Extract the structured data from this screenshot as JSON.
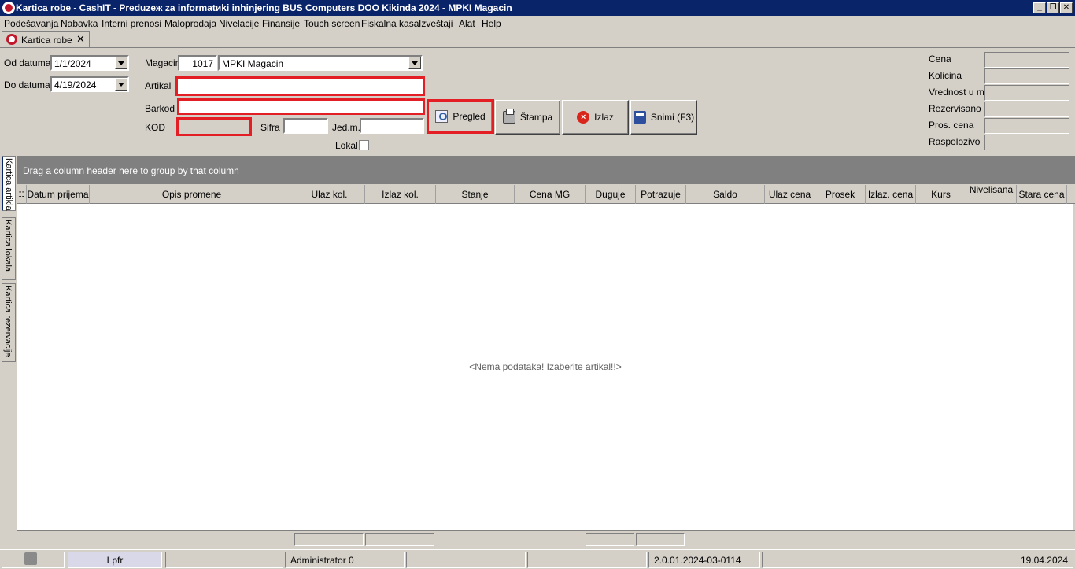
{
  "window": {
    "title": "Kartica robe - CashIT - Preduzeж za informatиki inhinjering BUS Computers DOO Kikinda 2024 - MPKI Magacin",
    "controls": [
      "_",
      "❐",
      "✕"
    ]
  },
  "menu": [
    "Podešavanja",
    "Nabavka",
    "Interni prenosi",
    "Maloprodaja",
    "Nivelacije",
    "Finansije",
    "Touch screen",
    "Fiskalna kasa",
    "Izveštaji",
    "Alat",
    "Help"
  ],
  "tab": {
    "label": "Kartica robe",
    "close": "✕"
  },
  "form": {
    "od_datuma_label": "Od datuma",
    "od_datuma": "1/1/2024",
    "do_datuma_label": "Do datuma",
    "do_datuma": "4/19/2024",
    "magacin_label": "Magacin",
    "magacin_code": "1017",
    "magacin_name": "MPKI Magacin",
    "artikal_label": "Artikal",
    "artikal_value": "",
    "barkod_label": "Barkod",
    "barkod_value": "",
    "kod_label": "KOD",
    "sifra_label": "Sifra",
    "jedm_label": "Jed.m.",
    "lokal_label": "Lokal"
  },
  "buttons": {
    "pregled": "Pregled",
    "stampa": "Štampa",
    "izlaz": "Izlaz",
    "snimi": "Snimi (F3)"
  },
  "summary": {
    "cena": "Cena",
    "kolicina": "Kolicina",
    "vrednost": "Vrednost u mg",
    "rezervisano": "Rezervisano",
    "pros_cena": "Pros. cena",
    "raspolozivo": "Raspolozivo"
  },
  "grid": {
    "group_panel_text": "Drag a column header here to group by that column",
    "columns": [
      "Datum prijema",
      "Opis promene",
      "Ulaz kol.",
      "Izlaz kol.",
      "Stanje",
      "Cena MG",
      "Duguje",
      "Potrazuje",
      "Saldo",
      "Ulaz cena",
      "Prosek",
      "Izlaz. cena",
      "Kurs",
      "Nivelisana",
      "Stara cena"
    ],
    "empty_message": "<Nema podataka! Izaberite artikal!!>"
  },
  "side_tabs": [
    "Kartica artikla",
    "Kartica lokala",
    "Kartica rezervacije"
  ],
  "status": {
    "lpfr": "Lpfr",
    "user": "Administrator 0",
    "version": "2.0.01.2024-03-0114",
    "date": "19.04.2024"
  },
  "colors": {
    "titlebar": "#0a246a",
    "highlight": "#e31e24",
    "group_panel": "#808080"
  }
}
